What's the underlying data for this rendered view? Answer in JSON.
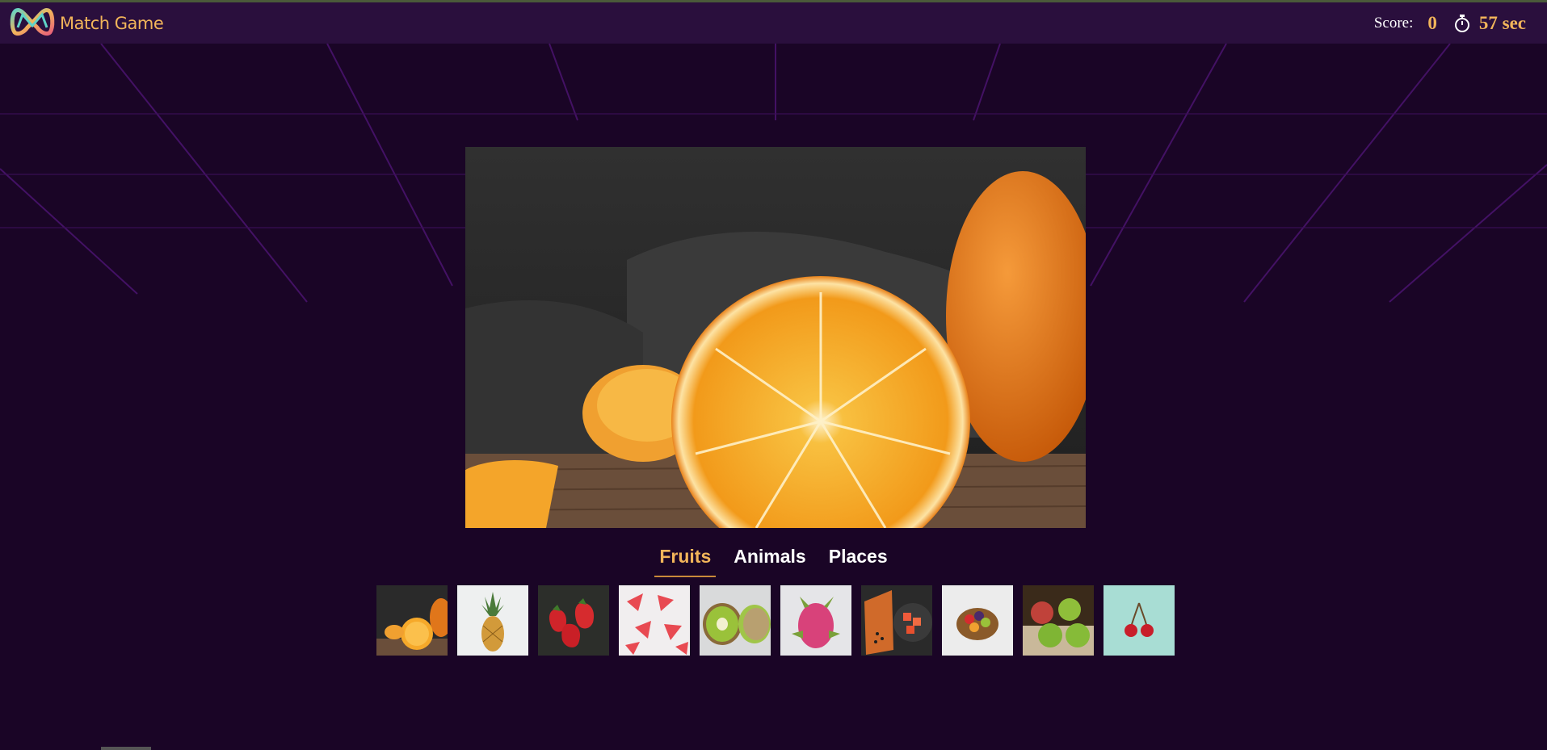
{
  "app": {
    "title": "Match Game",
    "colors": {
      "background": "#1a0526",
      "navbar": "#2a0f3d",
      "accent": "#f2b55a"
    }
  },
  "hud": {
    "score_label": "Score:",
    "score_value": "0",
    "timer_icon": "stopwatch-icon",
    "timer_value": "57 sec"
  },
  "hero": {
    "icon": "orange-photo",
    "subject": "orange"
  },
  "tabs": [
    {
      "label": "Fruits",
      "active": true
    },
    {
      "label": "Animals",
      "active": false
    },
    {
      "label": "Places",
      "active": false
    }
  ],
  "thumbnails": [
    {
      "name": "orange"
    },
    {
      "name": "pineapple"
    },
    {
      "name": "strawberry"
    },
    {
      "name": "watermelon"
    },
    {
      "name": "kiwi"
    },
    {
      "name": "dragon-fruit"
    },
    {
      "name": "papaya"
    },
    {
      "name": "fruit-bowl"
    },
    {
      "name": "apple"
    },
    {
      "name": "cherry"
    }
  ]
}
